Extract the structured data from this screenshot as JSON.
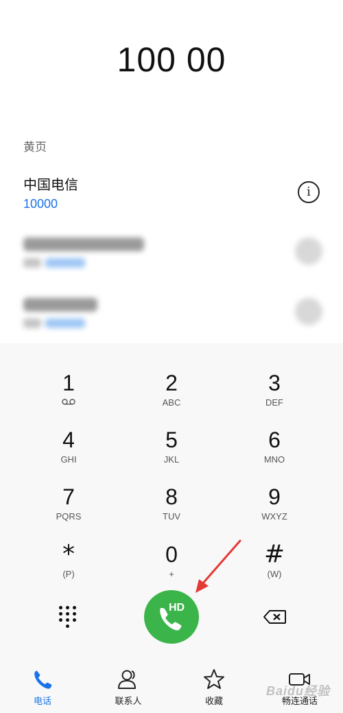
{
  "dialer": {
    "number": "100 00"
  },
  "results": {
    "section_label": "黄页",
    "contact": {
      "name": "中国电信",
      "number": "10000"
    }
  },
  "keypad": {
    "keys": [
      {
        "digit": "1",
        "letters": ""
      },
      {
        "digit": "2",
        "letters": "ABC"
      },
      {
        "digit": "3",
        "letters": "DEF"
      },
      {
        "digit": "4",
        "letters": "GHI"
      },
      {
        "digit": "5",
        "letters": "JKL"
      },
      {
        "digit": "6",
        "letters": "MNO"
      },
      {
        "digit": "7",
        "letters": "PQRS"
      },
      {
        "digit": "8",
        "letters": "TUV"
      },
      {
        "digit": "9",
        "letters": "WXYZ"
      },
      {
        "digit": "*",
        "letters": "(P)"
      },
      {
        "digit": "0",
        "letters": "+"
      },
      {
        "digit": "#",
        "letters": "(W)"
      }
    ]
  },
  "actions": {
    "call_hd_label": "HD",
    "call_color": "#3bb54a",
    "annotation_arrow_color": "#e53935"
  },
  "nav": {
    "items": [
      {
        "label": "电话",
        "icon": "phone-icon",
        "active": true
      },
      {
        "label": "联系人",
        "icon": "contacts-icon"
      },
      {
        "label": "收藏",
        "icon": "star-icon"
      },
      {
        "label": "畅连通话",
        "icon": "video-call-icon"
      }
    ],
    "accent": "#1a73e8"
  },
  "watermark": "Baidu经验"
}
